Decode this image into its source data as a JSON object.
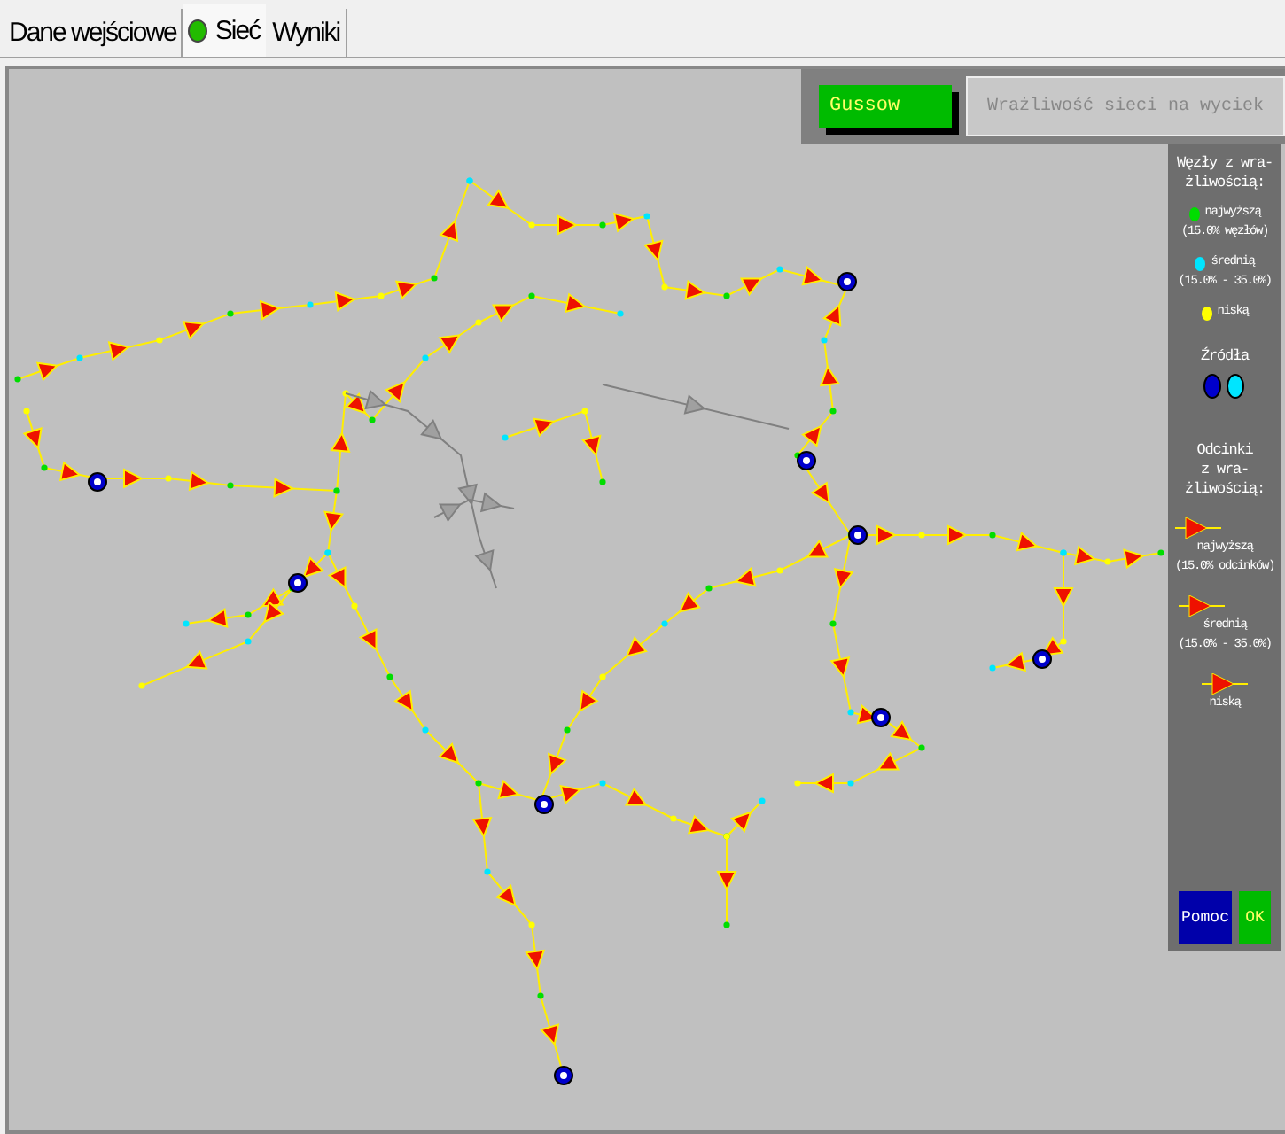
{
  "tabs": [
    {
      "label": "Dane wejściowe",
      "selected": false,
      "status_dot": false
    },
    {
      "label": "Sieć",
      "selected": true,
      "status_dot": true
    },
    {
      "label": "Wyniki",
      "selected": false,
      "status_dot": false
    }
  ],
  "top_panel": {
    "method_button": "Gussow",
    "title_field": {
      "value": "Wrażliwość sieci na wyciek",
      "disabled": true
    }
  },
  "legend": {
    "nodes_title": [
      "Węzły z wra-",
      "żliwością:"
    ],
    "nodes": [
      {
        "color": "#00dd00",
        "lines": [
          "najwyższą",
          "(15.0% węzłów)"
        ]
      },
      {
        "color": "#00e5ff",
        "lines": [
          "średnią",
          "(15.0% - 35.0%)"
        ]
      },
      {
        "color": "#ffff00",
        "lines": [
          "niską"
        ]
      }
    ],
    "sources_title": "Źródła",
    "sources": [
      {
        "color": "#0000cc"
      },
      {
        "color": "#00e5ff"
      }
    ],
    "segments_title": [
      "Odcinki",
      "z wra-",
      "żliwością:"
    ],
    "segments": [
      {
        "lines": [
          "najwyższą",
          "(15.0% odcinków)"
        ]
      },
      {
        "lines": [
          "średnią",
          "(15.0% - 35.0%)"
        ]
      },
      {
        "lines": [
          "niską"
        ]
      }
    ],
    "buttons": [
      {
        "label": "Pomoc",
        "kind": "help"
      },
      {
        "label": "OK",
        "kind": "ok"
      }
    ]
  }
}
